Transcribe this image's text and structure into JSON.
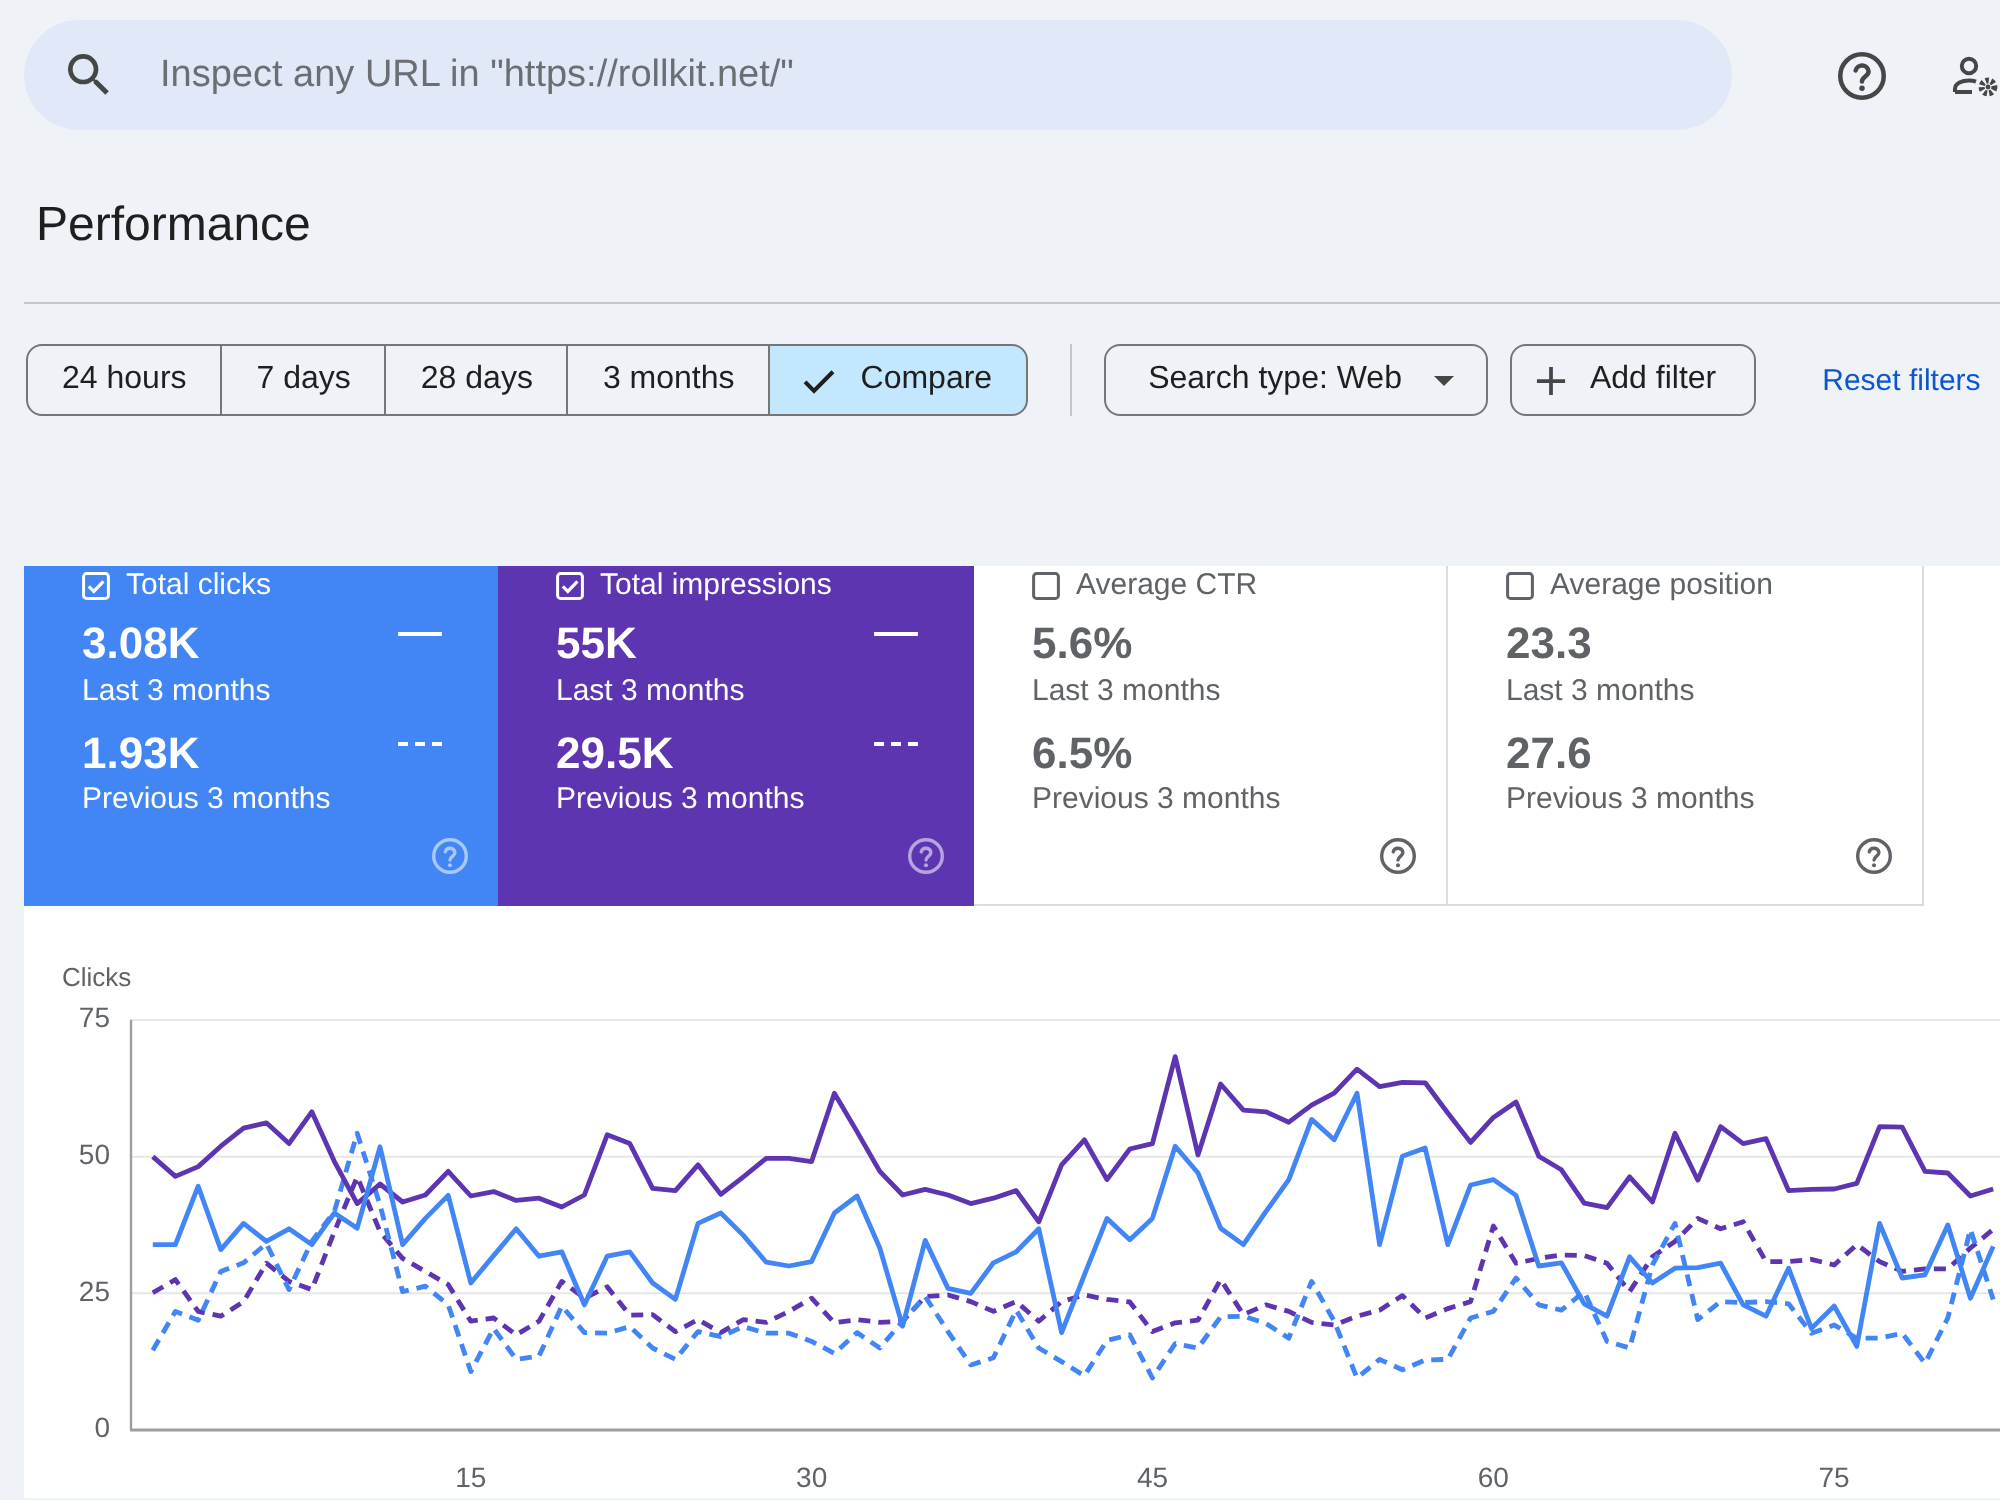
{
  "search": {
    "placeholder": "Inspect any URL in \"https://rollkit.net/\""
  },
  "page_title": "Performance",
  "segments": [
    {
      "label": "24 hours",
      "selected": false
    },
    {
      "label": "7 days",
      "selected": false
    },
    {
      "label": "28 days",
      "selected": false
    },
    {
      "label": "3 months",
      "selected": false
    },
    {
      "label": "Compare",
      "selected": true
    }
  ],
  "filters": [
    {
      "kind": "dropdown",
      "label": "Search type: Web"
    },
    {
      "kind": "add",
      "label": "Add filter"
    }
  ],
  "reset_link": "Reset filters",
  "metrics": [
    {
      "title": "Total clicks",
      "checked": true,
      "color": "#4285f4",
      "current": "3.08K",
      "current_label": "Last 3 months",
      "previous": "1.93K",
      "previous_label": "Previous 3 months"
    },
    {
      "title": "Total impressions",
      "checked": true,
      "color": "#5e35b1",
      "current": "55K",
      "current_label": "Last 3 months",
      "previous": "29.5K",
      "previous_label": "Previous 3 months"
    },
    {
      "title": "Average CTR",
      "checked": false,
      "current": "5.6%",
      "current_label": "Last 3 months",
      "previous": "6.5%",
      "previous_label": "Previous 3 months"
    },
    {
      "title": "Average position",
      "checked": false,
      "current": "23.3",
      "current_label": "Last 3 months",
      "previous": "27.6",
      "previous_label": "Previous 3 months"
    }
  ],
  "chart": {
    "chart_data": {
      "type": "line",
      "ylabel": "Clicks",
      "x": [
        1,
        2,
        3,
        4,
        5,
        6,
        7,
        8,
        9,
        10,
        11,
        12,
        13,
        14,
        15,
        16,
        17,
        18,
        19,
        20,
        21,
        22,
        23,
        24,
        25,
        26,
        27,
        28,
        29,
        30,
        31,
        32,
        33,
        34,
        35,
        36,
        37,
        38,
        39,
        40,
        41,
        42,
        43,
        44,
        45,
        46,
        47,
        48,
        49,
        50,
        51,
        52,
        53,
        54,
        55,
        56,
        57,
        58,
        59,
        60,
        61,
        62,
        63,
        64,
        65,
        66,
        67,
        68,
        69,
        70,
        71,
        72,
        73,
        74,
        75,
        76,
        77,
        78,
        79,
        80,
        81,
        82
      ],
      "xlim": [
        0,
        82.3
      ],
      "ylim": [
        0,
        75
      ],
      "xticks": [
        15,
        30,
        45,
        60,
        75
      ],
      "yticks": [
        0,
        25,
        50,
        75
      ],
      "series": [
        {
          "line_style": "dashed",
          "color": "#5e35b1",
          "values": [
            25.1,
            27.5,
            21.7,
            20.8,
            23.5,
            30.5,
            27.2,
            25.7,
            36.3,
            46.3,
            36.3,
            31.4,
            29,
            26.6,
            19.9,
            20.5,
            17.4,
            19.9,
            27.2,
            24.1,
            26.2,
            21,
            21.1,
            18,
            20.2,
            17.8,
            20.2,
            19.7,
            21.7,
            24.1,
            19.6,
            20.2,
            19.7,
            19.9,
            24.4,
            24.7,
            23.5,
            21.7,
            23.5,
            19.9,
            23.5,
            24.7,
            23.9,
            23.4,
            18,
            19.6,
            20.1,
            27.5,
            21.1,
            22.9,
            21.7,
            19.7,
            19.2,
            20.8,
            21.9,
            24.6,
            20.5,
            22.2,
            23.5,
            37.3,
            30.5,
            31.4,
            32,
            31.9,
            30.5,
            25.3,
            31.7,
            34.5,
            38.7,
            36.8,
            38.1,
            30.8,
            30.8,
            31.2,
            30.2,
            33.9,
            30.8,
            29,
            29.5,
            29.5,
            33.3,
            36.7
          ]
        },
        {
          "line_style": "dashed",
          "color": "#4285f4",
          "values": [
            14.6,
            21.7,
            20.1,
            29,
            30.6,
            34.1,
            25.7,
            34.5,
            40,
            54.3,
            41.2,
            25.3,
            26.3,
            22.9,
            10.7,
            18.6,
            12.9,
            13.5,
            22.7,
            17.8,
            17.7,
            18.9,
            15,
            12.9,
            18,
            17.1,
            18.9,
            17.7,
            17.7,
            16.2,
            14,
            17.8,
            15,
            19.9,
            24.4,
            18,
            11.9,
            13.2,
            21.9,
            15,
            12.5,
            9.9,
            16.4,
            17.4,
            9.5,
            15.8,
            15,
            20.7,
            20.8,
            19.5,
            16.8,
            27.2,
            19.9,
            9.5,
            12.9,
            11,
            12.8,
            12.9,
            20.5,
            21.7,
            27.8,
            22.9,
            21.9,
            25.3,
            16.2,
            15,
            30.2,
            37.8,
            20.2,
            23.5,
            23.3,
            23.5,
            23.1,
            17.7,
            19.2,
            16.8,
            16.8,
            17.7,
            12.2,
            20.5,
            36.7,
            23.9
          ]
        },
        {
          "line_style": "solid",
          "color": "#5e35b1",
          "values": [
            50,
            46.4,
            48.2,
            51.9,
            55.2,
            56.2,
            52.4,
            58.2,
            49.1,
            41.4,
            45,
            41.7,
            43,
            47.3,
            42.8,
            43.6,
            42,
            42.4,
            40.8,
            43,
            54,
            52.4,
            44.2,
            43.8,
            48.5,
            43.1,
            46.3,
            49.7,
            49.7,
            49.1,
            61.6,
            54.6,
            47.3,
            43,
            44,
            43,
            41.4,
            42.4,
            43.8,
            38.1,
            48.5,
            53.1,
            45.8,
            51.4,
            52.4,
            68.3,
            50.3,
            63.3,
            58.5,
            58.2,
            56.3,
            59.4,
            61.6,
            66,
            62.8,
            63.6,
            63.5,
            58,
            52.6,
            57.2,
            60,
            50.1,
            47.6,
            41.5,
            40.7,
            46.3,
            41.7,
            54.3,
            45.7,
            55.5,
            52.4,
            53.3,
            43.8,
            44,
            44.1,
            45.1,
            55.5,
            55.4,
            47.3,
            47,
            42.8,
            44.1
          ]
        },
        {
          "line_style": "solid",
          "color": "#4285f4",
          "values": [
            33.9,
            33.9,
            44.6,
            33,
            37.8,
            34.5,
            36.8,
            33.9,
            39.7,
            36.9,
            51.8,
            33.9,
            38.7,
            42.9,
            26.9,
            31.9,
            36.8,
            31.8,
            32.6,
            22.9,
            31.8,
            32.6,
            26.9,
            23.9,
            37.8,
            39.7,
            35.6,
            30.7,
            30,
            30.8,
            39.7,
            42.8,
            33.3,
            19,
            34.7,
            25.9,
            25,
            30.6,
            32.6,
            36.8,
            17.8,
            28.4,
            38.7,
            34.8,
            38.7,
            51.9,
            47,
            36.9,
            33.9,
            40,
            45.8,
            56.8,
            53.1,
            61.6,
            33.9,
            50.1,
            51.6,
            33.9,
            44.8,
            45.8,
            42.9,
            30,
            30.6,
            23.1,
            20.8,
            31.7,
            26.9,
            29.6,
            29.7,
            30.5,
            22.9,
            20.8,
            29.6,
            18.6,
            22.7,
            15.3,
            37.8,
            27.8,
            28.4,
            37.5,
            24.1,
            33.6
          ]
        }
      ]
    }
  }
}
